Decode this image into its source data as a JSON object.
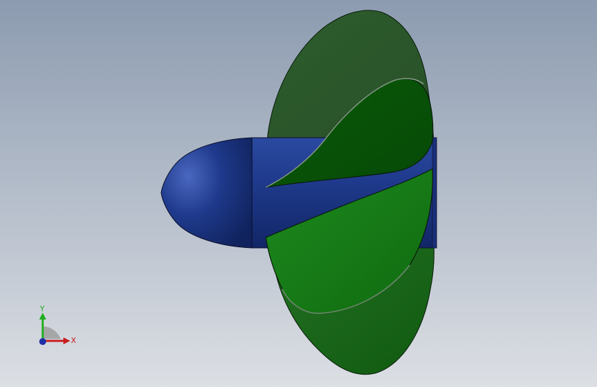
{
  "viewport": {
    "background_top": "#8c9bb0",
    "background_bottom": "#dcdfe4"
  },
  "model": {
    "hub_color": "#1f3a8c",
    "blade_color_dark": "#2f5a2f",
    "blade_color_mid": "#0e6a0e",
    "blade_color_light": "#1a8a1a",
    "edge_color": "#0a1a0a"
  },
  "triad": {
    "x_label": "X",
    "y_label": "Y",
    "x_color": "#c81e1e",
    "y_color": "#1fae1f",
    "z_color": "#1e2ea8"
  }
}
